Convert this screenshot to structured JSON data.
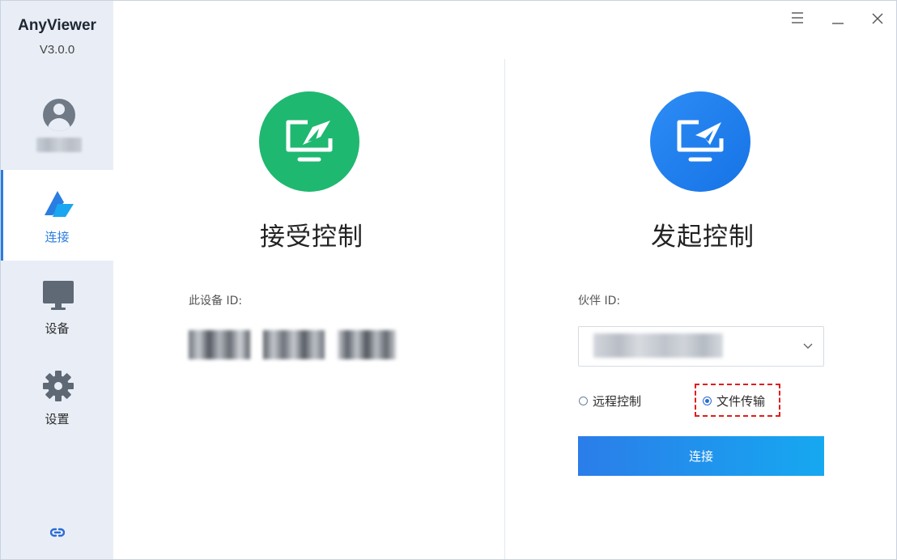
{
  "app": {
    "name": "AnyViewer",
    "version": "V3.0.0"
  },
  "user": {
    "name": ""
  },
  "nav": {
    "items": [
      {
        "label": "连接",
        "icon": "connect-icon",
        "active": true
      },
      {
        "label": "设备",
        "icon": "monitor-icon",
        "active": false
      },
      {
        "label": "设置",
        "icon": "gear-icon",
        "active": false
      }
    ],
    "footer_icon": "link-icon"
  },
  "window_controls": {
    "menu_icon": "menu-icon",
    "minimize_icon": "minimize-icon",
    "close_icon": "close-icon"
  },
  "receive": {
    "title": "接受控制",
    "device_id_label": "此设备 ID:",
    "icon": "remote-desktop-icon",
    "accent": "#1fb870"
  },
  "initiate": {
    "title": "发起控制",
    "partner_id_label": "伙伴 ID:",
    "icon": "remote-control-icon",
    "accent": "#1d7ff0",
    "mode_options": [
      {
        "label": "远程控制",
        "selected": false
      },
      {
        "label": "文件传输",
        "selected": true
      }
    ],
    "connect_label": "连接",
    "highlight_color": "#e11d1d"
  }
}
